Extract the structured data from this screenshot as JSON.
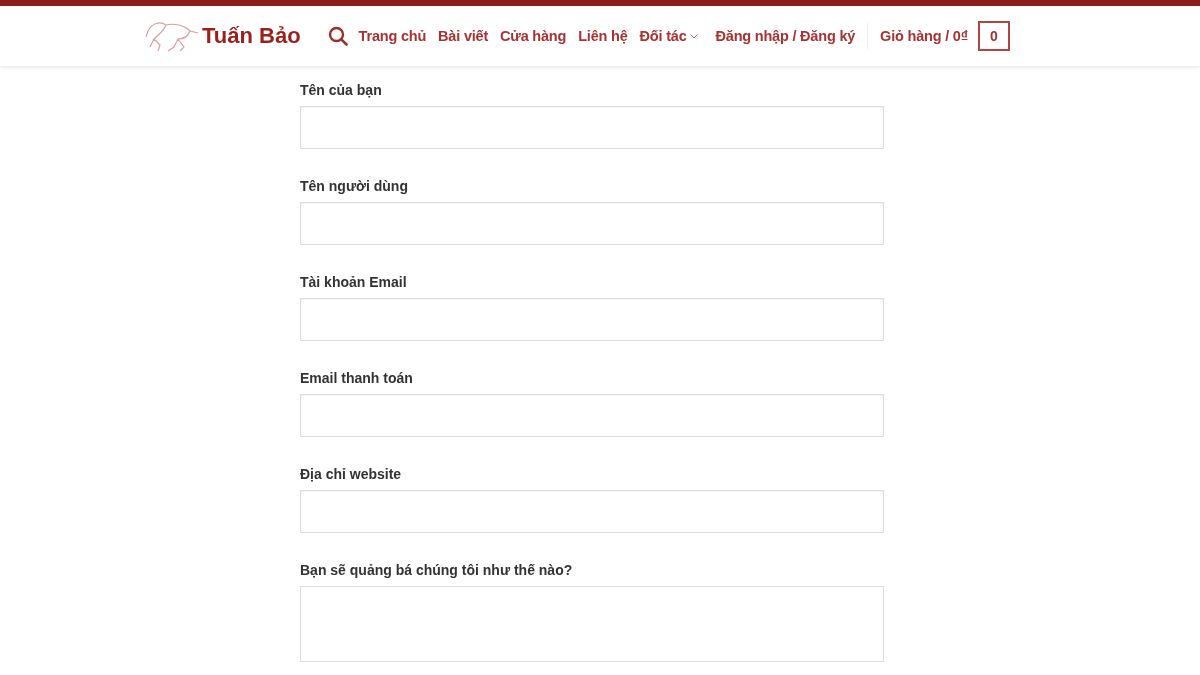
{
  "header": {
    "logo": "Tuấn Bảo",
    "nav": [
      {
        "label": "Trang chủ",
        "dropdown": false
      },
      {
        "label": "Bài viết",
        "dropdown": false
      },
      {
        "label": "Cửa hàng",
        "dropdown": false
      },
      {
        "label": "Liên hệ",
        "dropdown": false
      },
      {
        "label": "Đối tác",
        "dropdown": true
      }
    ],
    "account": "Đăng nhập / Đăng ký",
    "cart": "Giỏ hàng / 0₫",
    "cart_count": "0"
  },
  "form": {
    "fields": [
      {
        "label": "Tên của bạn",
        "kind": "input"
      },
      {
        "label": "Tên người dùng",
        "kind": "input"
      },
      {
        "label": "Tài khoản Email",
        "kind": "input"
      },
      {
        "label": "Email thanh toán",
        "kind": "input"
      },
      {
        "label": "Địa chỉ website",
        "kind": "input"
      },
      {
        "label": "Bạn sẽ quảng bá chúng tôi như thế nào?",
        "kind": "textarea"
      }
    ]
  }
}
